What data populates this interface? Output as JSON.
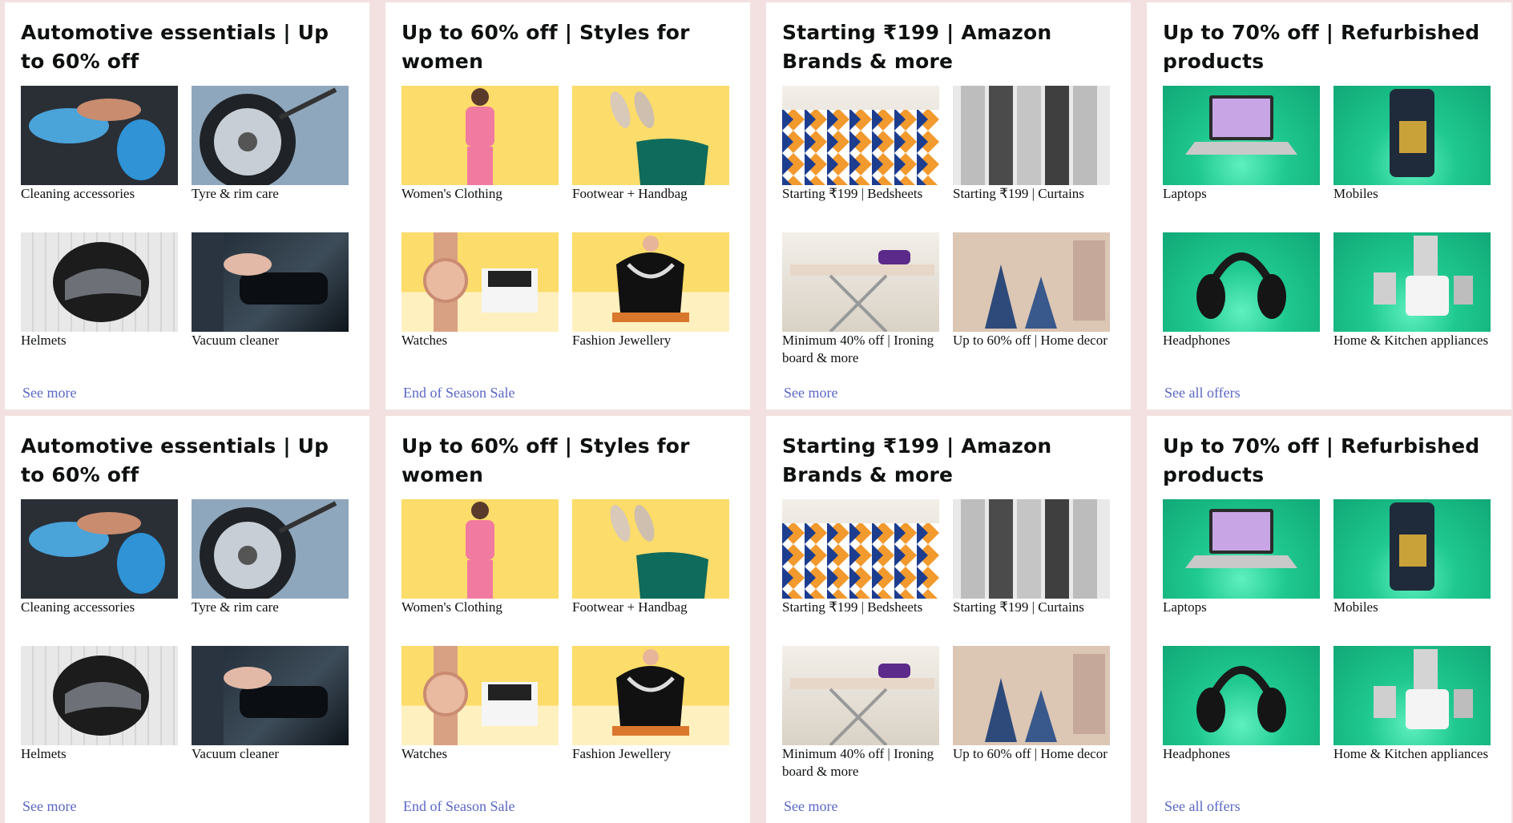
{
  "cards": [
    {
      "title": "Automotive essentials | Up to 60% off",
      "link": "See more",
      "tiles": [
        {
          "label": "Cleaning accessories",
          "icon": "car-cleaning-image"
        },
        {
          "label": "Tyre & rim care",
          "icon": "tyre-rim-image"
        },
        {
          "label": "Helmets",
          "icon": "helmet-image"
        },
        {
          "label": "Vacuum cleaner",
          "icon": "vacuum-image"
        }
      ]
    },
    {
      "title": "Up to 60% off | Styles for women",
      "link": "End of Season Sale",
      "tiles": [
        {
          "label": "Women's Clothing",
          "icon": "woman-dress-image"
        },
        {
          "label": "Footwear + Handbag",
          "icon": "footwear-handbag-image"
        },
        {
          "label": "Watches",
          "icon": "watch-image"
        },
        {
          "label": "Fashion Jewellery",
          "icon": "necklace-image"
        }
      ]
    },
    {
      "title": "Starting ₹199 | Amazon Brands & more",
      "link": "See more",
      "tiles": [
        {
          "label": "Starting ₹199 | Bedsheets",
          "icon": "bedsheet-image"
        },
        {
          "label": "Starting ₹199 | Curtains",
          "icon": "curtain-image"
        },
        {
          "label": "Minimum 40% off | Ironing board & more",
          "icon": "ironing-board-image"
        },
        {
          "label": "Up to 60% off | Home decor",
          "icon": "deer-decor-image"
        }
      ]
    },
    {
      "title": "Up to 70% off | Refurbished products",
      "link": "See all offers",
      "tiles": [
        {
          "label": "Laptops",
          "icon": "laptop-image"
        },
        {
          "label": "Mobiles",
          "icon": "mobile-image"
        },
        {
          "label": "Headphones",
          "icon": "headphones-image"
        },
        {
          "label": "Home & Kitchen appliances",
          "icon": "mixer-image"
        }
      ]
    },
    {
      "title": "Automotive essentials | Up to 60% off",
      "link": "See more",
      "tiles": [
        {
          "label": "Cleaning accessories",
          "icon": "car-cleaning-image"
        },
        {
          "label": "Tyre & rim care",
          "icon": "tyre-rim-image"
        },
        {
          "label": "Helmets",
          "icon": "helmet-image"
        },
        {
          "label": "Vacuum cleaner",
          "icon": "vacuum-image"
        }
      ]
    },
    {
      "title": "Up to 60% off | Styles for women",
      "link": "End of Season Sale",
      "tiles": [
        {
          "label": "Women's Clothing",
          "icon": "woman-dress-image"
        },
        {
          "label": "Footwear + Handbag",
          "icon": "footwear-handbag-image"
        },
        {
          "label": "Watches",
          "icon": "watch-image"
        },
        {
          "label": "Fashion Jewellery",
          "icon": "necklace-image"
        }
      ]
    },
    {
      "title": "Starting ₹199 | Amazon Brands & more",
      "link": "See more",
      "tiles": [
        {
          "label": "Starting ₹199 | Bedsheets",
          "icon": "bedsheet-image"
        },
        {
          "label": "Starting ₹199 | Curtains",
          "icon": "curtain-image"
        },
        {
          "label": "Minimum 40% off | Ironing board & more",
          "icon": "ironing-board-image"
        },
        {
          "label": "Up to 60% off | Home decor",
          "icon": "deer-decor-image"
        }
      ]
    },
    {
      "title": "Up to 70% off | Refurbished products",
      "link": "See all offers",
      "tiles": [
        {
          "label": "Laptops",
          "icon": "laptop-image"
        },
        {
          "label": "Mobiles",
          "icon": "mobile-image"
        },
        {
          "label": "Headphones",
          "icon": "headphones-image"
        },
        {
          "label": "Home & Kitchen appliances",
          "icon": "mixer-image"
        }
      ]
    }
  ],
  "colors": {
    "page_bg": "#f3e1e1",
    "card_bg": "#ffffff",
    "link": "#5b67c4",
    "title": "#0f1111"
  }
}
